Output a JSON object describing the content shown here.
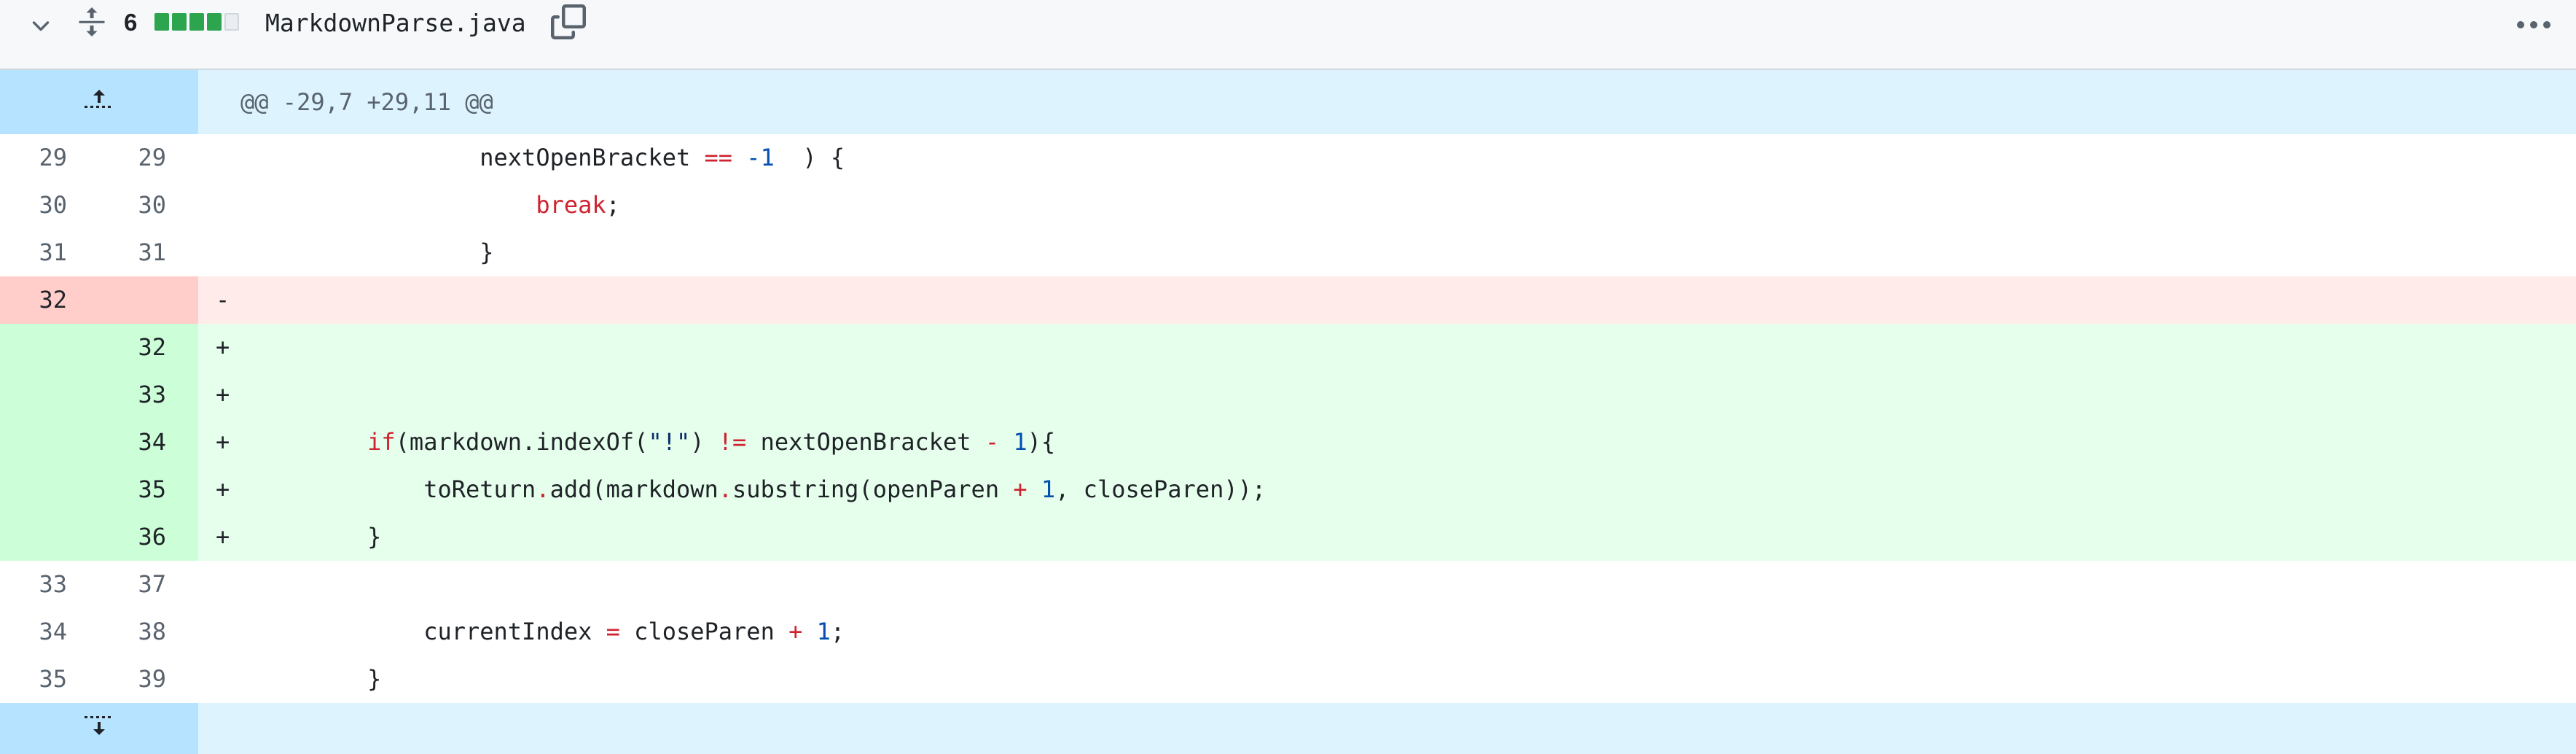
{
  "header": {
    "diffstat_count": "6",
    "diffstat_blocks": [
      "added",
      "added",
      "added",
      "added",
      "neutral"
    ],
    "file_name": "MarkdownParse.java",
    "icons": {
      "collapse": "chevron-down-icon",
      "expand_all": "unfold-icon",
      "copy": "copy-icon",
      "more": "kebab-horizontal-icon"
    }
  },
  "hunk_top": {
    "text": "@@ -29,7 +29,11 @@",
    "expand_icon": "fold-up-icon"
  },
  "hunk_bottom": {
    "expand_icon": "fold-down-icon"
  },
  "lines": [
    {
      "type": "ctx",
      "old": "29",
      "new": "29",
      "marker": "",
      "indent": "                ",
      "tokens": [
        [
          "",
          "nextOpenBracket "
        ],
        [
          "op",
          "=="
        ],
        [
          "",
          " "
        ],
        [
          "nm",
          "-1"
        ],
        [
          "",
          "  ) {"
        ]
      ]
    },
    {
      "type": "ctx",
      "old": "30",
      "new": "30",
      "marker": "",
      "indent": "                    ",
      "tokens": [
        [
          "kw",
          "break"
        ],
        [
          "",
          ";"
        ]
      ]
    },
    {
      "type": "ctx",
      "old": "31",
      "new": "31",
      "marker": "",
      "indent": "                ",
      "tokens": [
        [
          "",
          "}"
        ]
      ]
    },
    {
      "type": "del",
      "old": "32",
      "new": "",
      "marker": "-",
      "indent": "",
      "tokens": []
    },
    {
      "type": "add",
      "old": "",
      "new": "32",
      "marker": "+",
      "indent": "",
      "tokens": []
    },
    {
      "type": "add",
      "old": "",
      "new": "33",
      "marker": "+",
      "indent": "",
      "tokens": []
    },
    {
      "type": "add",
      "old": "",
      "new": "34",
      "marker": "+",
      "indent": "        ",
      "tokens": [
        [
          "kw",
          "if"
        ],
        [
          "",
          "(markdown.indexOf("
        ],
        [
          "st",
          "\"!\""
        ],
        [
          "",
          ") "
        ],
        [
          "op",
          "!="
        ],
        [
          "",
          " nextOpenBracket "
        ],
        [
          "op",
          "-"
        ],
        [
          "",
          " "
        ],
        [
          "nm",
          "1"
        ],
        [
          "",
          "){"
        ]
      ]
    },
    {
      "type": "add",
      "old": "",
      "new": "35",
      "marker": "+",
      "indent": "            ",
      "tokens": [
        [
          "",
          "toReturn"
        ],
        [
          "op",
          "."
        ],
        [
          "",
          "add(markdown"
        ],
        [
          "op",
          "."
        ],
        [
          "",
          "substring(openParen "
        ],
        [
          "op",
          "+"
        ],
        [
          "",
          " "
        ],
        [
          "nm",
          "1"
        ],
        [
          "",
          ", closeParen));"
        ]
      ]
    },
    {
      "type": "add",
      "old": "",
      "new": "36",
      "marker": "+",
      "indent": "        ",
      "tokens": [
        [
          "",
          "}"
        ]
      ]
    },
    {
      "type": "ctx",
      "old": "33",
      "new": "37",
      "marker": "",
      "indent": "",
      "tokens": []
    },
    {
      "type": "ctx",
      "old": "34",
      "new": "38",
      "marker": "",
      "indent": "            ",
      "tokens": [
        [
          "",
          "currentIndex "
        ],
        [
          "op",
          "="
        ],
        [
          "",
          " closeParen "
        ],
        [
          "op",
          "+"
        ],
        [
          "",
          " "
        ],
        [
          "nm",
          "1"
        ],
        [
          "",
          ";"
        ]
      ]
    },
    {
      "type": "ctx",
      "old": "35",
      "new": "39",
      "marker": "",
      "indent": "        ",
      "tokens": [
        [
          "",
          "}"
        ]
      ]
    }
  ],
  "colors": {
    "added_block": "#2da44e",
    "deleted_line_bg": "#ffebe9",
    "added_line_bg": "#e6ffec",
    "hunk_bg": "#ddf4ff"
  }
}
